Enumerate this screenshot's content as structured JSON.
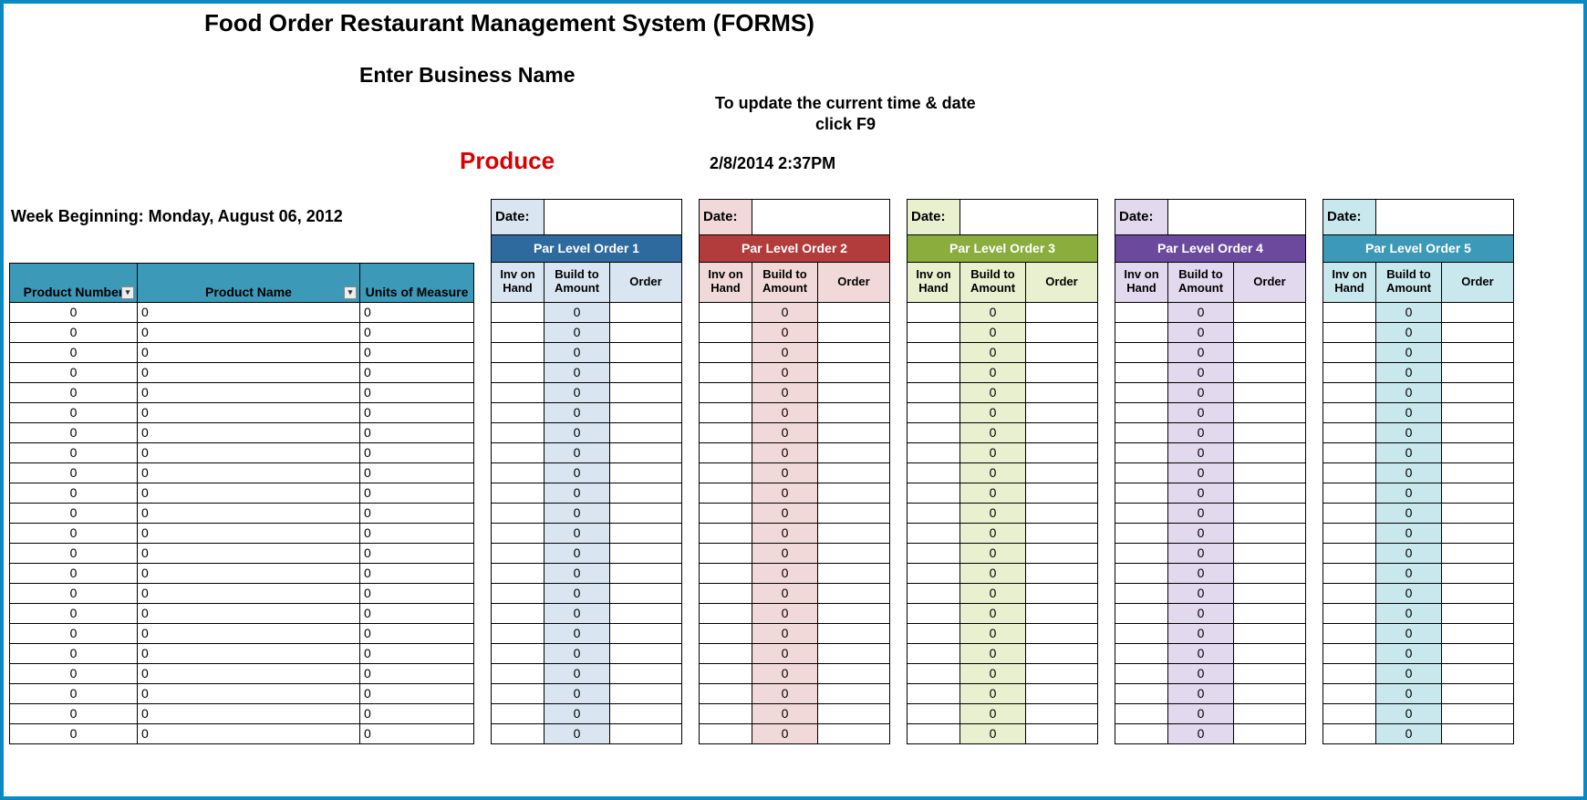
{
  "header": {
    "title": "Food Order Restaurant Management System (FORMS)",
    "subtitle": "Enter Business Name",
    "hint_line1": "To update the current time & date",
    "hint_line2": "click F9",
    "category": "Produce",
    "datetime": "2/8/2014 2:37PM"
  },
  "week_label": "Week Beginning: Monday, August 06, 2012",
  "product_headers": {
    "pn": "Product Number",
    "pname": "Product Name",
    "um": "Units of Measure"
  },
  "order_labels": {
    "date": "Date:",
    "inv": "Inv on Hand",
    "build": "Build to Amount",
    "order": "Order"
  },
  "blocks": [
    {
      "title": "Par Level Order 1",
      "theme": "t1"
    },
    {
      "title": "Par Level Order 2",
      "theme": "t2"
    },
    {
      "title": "Par Level Order 3",
      "theme": "t3"
    },
    {
      "title": "Par Level Order 4",
      "theme": "t4"
    },
    {
      "title": "Par Level Order 5",
      "theme": "t5"
    }
  ],
  "rows": [
    {
      "pn": "0",
      "pname": "0",
      "um": "0",
      "build": "0"
    },
    {
      "pn": "0",
      "pname": "0",
      "um": "0",
      "build": "0"
    },
    {
      "pn": "0",
      "pname": "0",
      "um": "0",
      "build": "0"
    },
    {
      "pn": "0",
      "pname": "0",
      "um": "0",
      "build": "0"
    },
    {
      "pn": "0",
      "pname": "0",
      "um": "0",
      "build": "0"
    },
    {
      "pn": "0",
      "pname": "0",
      "um": "0",
      "build": "0"
    },
    {
      "pn": "0",
      "pname": "0",
      "um": "0",
      "build": "0"
    },
    {
      "pn": "0",
      "pname": "0",
      "um": "0",
      "build": "0"
    },
    {
      "pn": "0",
      "pname": "0",
      "um": "0",
      "build": "0"
    },
    {
      "pn": "0",
      "pname": "0",
      "um": "0",
      "build": "0"
    },
    {
      "pn": "0",
      "pname": "0",
      "um": "0",
      "build": "0"
    },
    {
      "pn": "0",
      "pname": "0",
      "um": "0",
      "build": "0"
    },
    {
      "pn": "0",
      "pname": "0",
      "um": "0",
      "build": "0"
    },
    {
      "pn": "0",
      "pname": "0",
      "um": "0",
      "build": "0"
    },
    {
      "pn": "0",
      "pname": "0",
      "um": "0",
      "build": "0"
    },
    {
      "pn": "0",
      "pname": "0",
      "um": "0",
      "build": "0"
    },
    {
      "pn": "0",
      "pname": "0",
      "um": "0",
      "build": "0"
    },
    {
      "pn": "0",
      "pname": "0",
      "um": "0",
      "build": "0"
    },
    {
      "pn": "0",
      "pname": "0",
      "um": "0",
      "build": "0"
    },
    {
      "pn": "0",
      "pname": "0",
      "um": "0",
      "build": "0"
    },
    {
      "pn": "0",
      "pname": "0",
      "um": "0",
      "build": "0"
    },
    {
      "pn": "0",
      "pname": "0",
      "um": "0",
      "build": "0"
    }
  ]
}
